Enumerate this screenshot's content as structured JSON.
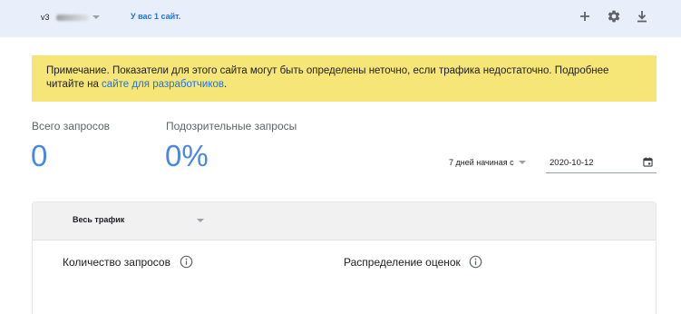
{
  "header": {
    "version_prefix": "v3",
    "site_count": "У вас 1 сайт.",
    "icons": [
      "add-icon",
      "settings-icon",
      "download-icon"
    ]
  },
  "notice": {
    "text": "Примечание. Показатели для этого сайта могут быть определены неточно, если трафика недостаточно. Подробнее читайте на ",
    "link": "сайте для разработчиков",
    "suffix": "."
  },
  "metrics": {
    "total_label": "Всего запросов",
    "total_value": "0",
    "suspicious_label": "Подозрительные запросы",
    "suspicious_value": "0%"
  },
  "filters": {
    "range_label": "7 дней начиная с",
    "date_value": "2020-10-12"
  },
  "card": {
    "traffic_filter": "Весь трафик",
    "requests_title": "Количество запросов",
    "distribution_title": "Распределение оценок"
  },
  "colors": {
    "header_bg": "#e8effa",
    "notice_bg": "#f6e577",
    "accent": "#1a73e8",
    "metric_value": "#4a86e8"
  }
}
